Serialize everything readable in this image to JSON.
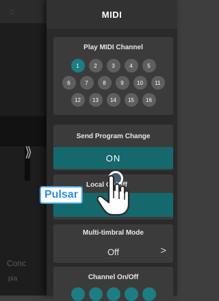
{
  "panel": {
    "title": "MIDI"
  },
  "play_midi_channel": {
    "title": "Play MIDI Channel",
    "selected": "1",
    "rows": [
      [
        "1",
        "2",
        "3",
        "4",
        "5"
      ],
      [
        "6",
        "7",
        "8",
        "9",
        "10",
        "11"
      ],
      [
        "12",
        "13",
        "14",
        "15",
        "16"
      ]
    ]
  },
  "send_program_change": {
    "title": "Send Program Change",
    "value": "ON"
  },
  "local_onoff": {
    "title": "Local On/Off",
    "visible_title": "Local On/Off"
  },
  "multitimbral": {
    "title": "Multi-timbral Mode",
    "value": "Off",
    "chevron": ">"
  },
  "channel_onoff": {
    "title": "Channel On/Off"
  },
  "annotation": {
    "label": "Pulsar"
  },
  "background": {
    "chevron": "⟫",
    "label": "Conc",
    "sublabel": "pia"
  },
  "colors": {
    "accent": "#15686c",
    "selected_channel": "#1c7d84",
    "annotation_blue": "#2a8de0"
  }
}
